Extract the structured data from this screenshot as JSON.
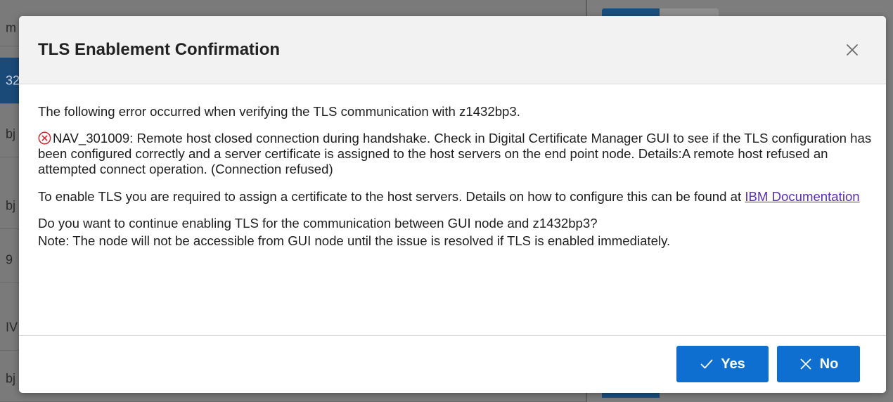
{
  "background": {
    "row_fragments": [
      "m",
      "32",
      "bj",
      "bj",
      "9",
      "IV",
      "bj"
    ]
  },
  "dialog": {
    "title": "TLS Enablement Confirmation",
    "close_icon": "close-icon",
    "intro": "The following error occurred when verifying the TLS communication with z1432bp3.",
    "error_icon": "error-circle-icon",
    "error_color": "#d8262c",
    "error_message": "NAV_301009: Remote host closed connection during handshake. Check in Digital Certificate Manager GUI to see if the TLS configuration has been configured correctly and a server certificate is assigned to the host servers on the end point node. Details:A remote host refused an attempted connect operation. (Connection refused)",
    "instructions_prefix": "To enable TLS you are required to assign a certificate to the host servers. Details on how to configure this can be found at ",
    "doc_link_label": "IBM Documentation",
    "question": "Do you want to continue enabling TLS for the communication between GUI node and z1432bp3?",
    "note": "Note: The node will not be accessible from GUI node until the issue is resolved if TLS is enabled immediately.",
    "buttons": {
      "yes_label": "Yes",
      "yes_icon": "checkmark-icon",
      "no_label": "No",
      "no_icon": "x-icon",
      "primary_color": "#0f6fd1"
    }
  }
}
